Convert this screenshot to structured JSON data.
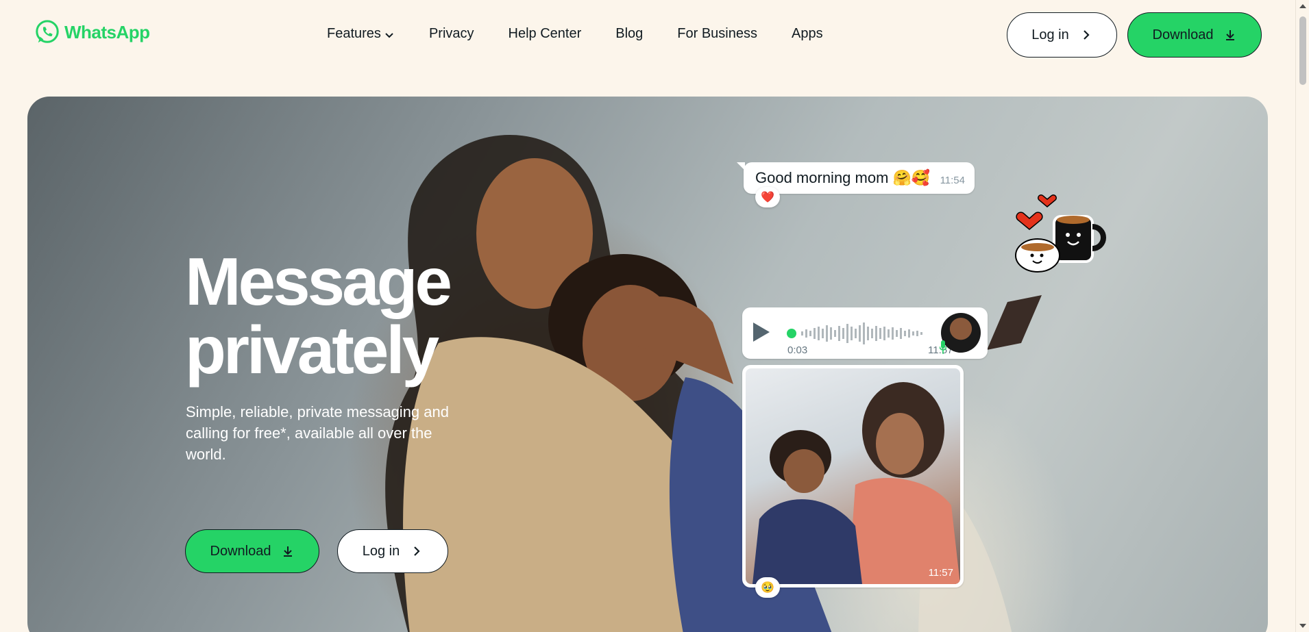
{
  "brand": {
    "name": "WhatsApp",
    "color": "#25d366"
  },
  "nav": {
    "items": [
      {
        "label": "Features",
        "has_dropdown": true
      },
      {
        "label": "Privacy"
      },
      {
        "label": "Help Center"
      },
      {
        "label": "Blog"
      },
      {
        "label": "For Business"
      },
      {
        "label": "Apps"
      }
    ]
  },
  "header_actions": {
    "login_label": "Log in",
    "download_label": "Download"
  },
  "hero": {
    "title": "Message\nprivately",
    "subtitle": "Simple, reliable, private messaging and calling for free*, available all over the world.",
    "download_label": "Download",
    "login_label": "Log in"
  },
  "chat": {
    "message": {
      "text": "Good morning mom 🤗🥰",
      "time": "11:54",
      "reaction": "❤️"
    },
    "voice_note": {
      "duration": "0:03",
      "time": "11:57"
    },
    "photo": {
      "time": "11:57",
      "reaction": "🥹"
    }
  },
  "icons": {
    "logo": "whatsapp-logo-icon",
    "dropdown": "chevron-down-icon",
    "login": "chevron-right-icon",
    "download": "download-icon",
    "play": "play-icon",
    "mic": "microphone-icon",
    "sticker": "coffee-cups-sticker"
  }
}
